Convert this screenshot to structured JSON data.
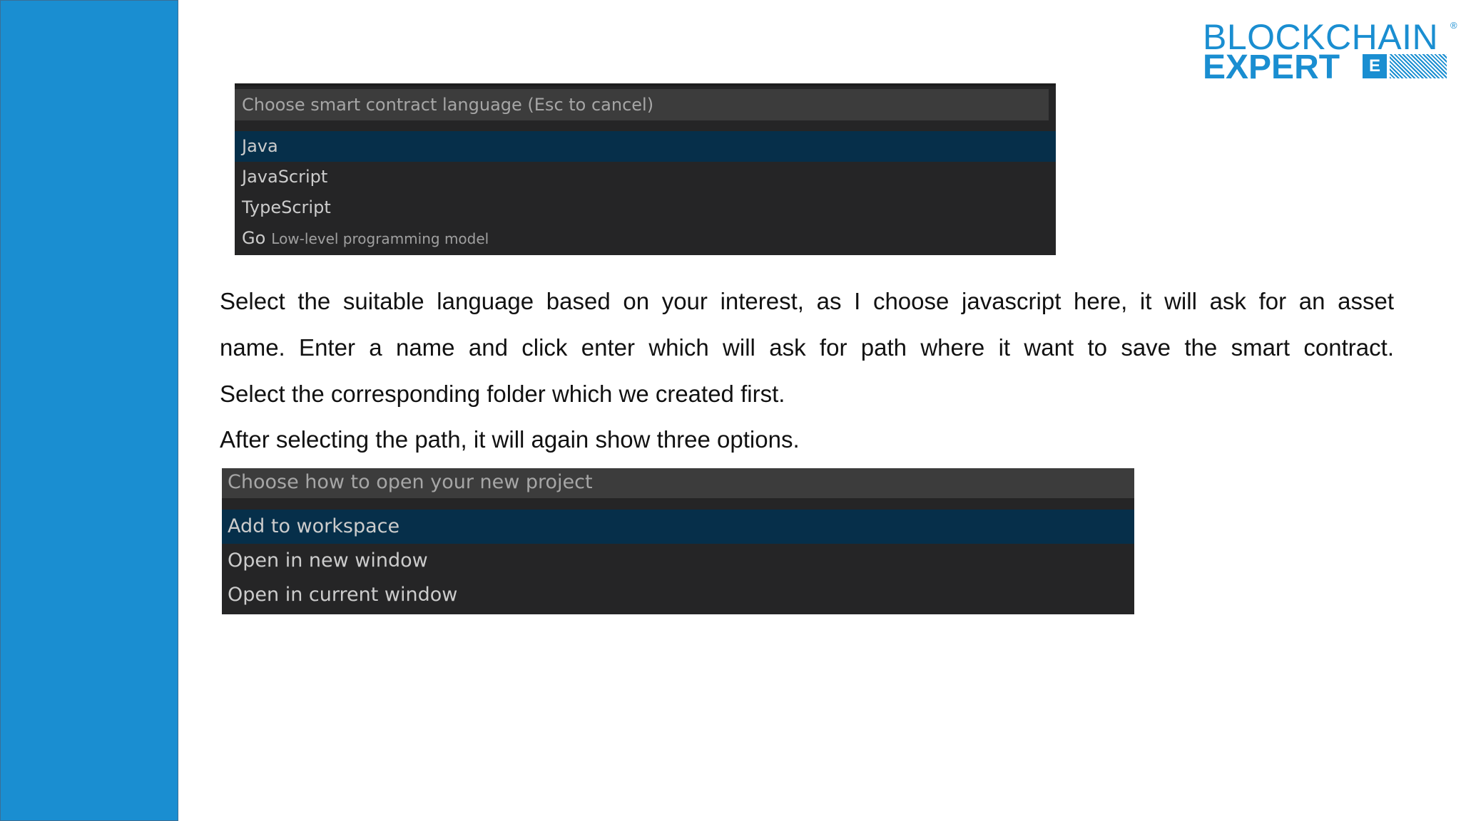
{
  "colors": {
    "sidebar": "#1a8ed1",
    "brand_blue": "#1a8ed1",
    "selected_row": "#062f4a",
    "panel": "#252526",
    "input_bg": "#3c3c3c"
  },
  "logo": {
    "line1": "BLOCKCHAIN",
    "registered": "®",
    "line2": "EXPERT",
    "badge": "E"
  },
  "language_picker": {
    "placeholder": "Choose smart contract language (Esc to cancel)",
    "items": [
      {
        "label": "Java",
        "description": ""
      },
      {
        "label": "JavaScript",
        "description": ""
      },
      {
        "label": "TypeScript",
        "description": ""
      },
      {
        "label": "Go",
        "description": "Low-level programming model"
      }
    ],
    "selected": "Java"
  },
  "body_text": {
    "line1": "Select the suitable language based on your interest, as I choose javascript here, it will ask for an asset",
    "line2": "name. Enter a name and click enter which will ask for path where it want to save the smart contract.",
    "line3": "Select the corresponding folder which we created first.",
    "line4": "After selecting the path, it will again show three options."
  },
  "open_picker": {
    "placeholder": "Choose how to open your new project",
    "items": [
      "Add to workspace",
      "Open in new window",
      "Open in current window"
    ],
    "selected": "Add to workspace"
  }
}
